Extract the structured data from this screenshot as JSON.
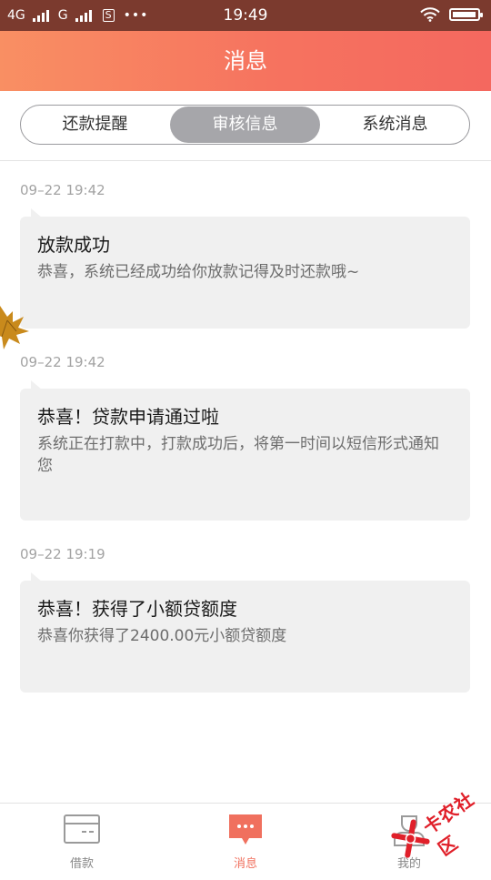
{
  "status_bar": {
    "network_1": "4G",
    "network_2": "G",
    "sim_icon_text": "S",
    "more": "•••",
    "time": "19:49",
    "battery_level": 0.95
  },
  "header": {
    "title": "消息"
  },
  "tabs": [
    {
      "label": "还款提醒",
      "active": false
    },
    {
      "label": "审核信息",
      "active": true
    },
    {
      "label": "系统消息",
      "active": false
    }
  ],
  "messages": [
    {
      "time": "09–22 19:42",
      "title": "放款成功",
      "body": "恭喜，系统已经成功给你放款记得及时还款哦~"
    },
    {
      "time": "09–22 19:42",
      "title": "恭喜！贷款申请通过啦",
      "body": "系统正在打款中，打款成功后，将第一时间以短信形式通知您"
    },
    {
      "time": "09–22 19:19",
      "title": "恭喜！获得了小额贷额度",
      "body": "恭喜你获得了2400.00元小额贷额度"
    }
  ],
  "bottom_nav": [
    {
      "label": "借款",
      "icon": "card-icon",
      "active": false
    },
    {
      "label": "消息",
      "icon": "message-icon",
      "active": true
    },
    {
      "label": "我的",
      "icon": "profile-icon",
      "active": false
    }
  ],
  "watermark": {
    "text": "卡农社区"
  },
  "colors": {
    "header_start": "#f98f63",
    "header_end": "#f4685f",
    "accent": "#f0705e",
    "tab_active": "#a6a6aa",
    "bubble_bg": "#f0f0f0",
    "status_bar": "#7b3a2e"
  }
}
